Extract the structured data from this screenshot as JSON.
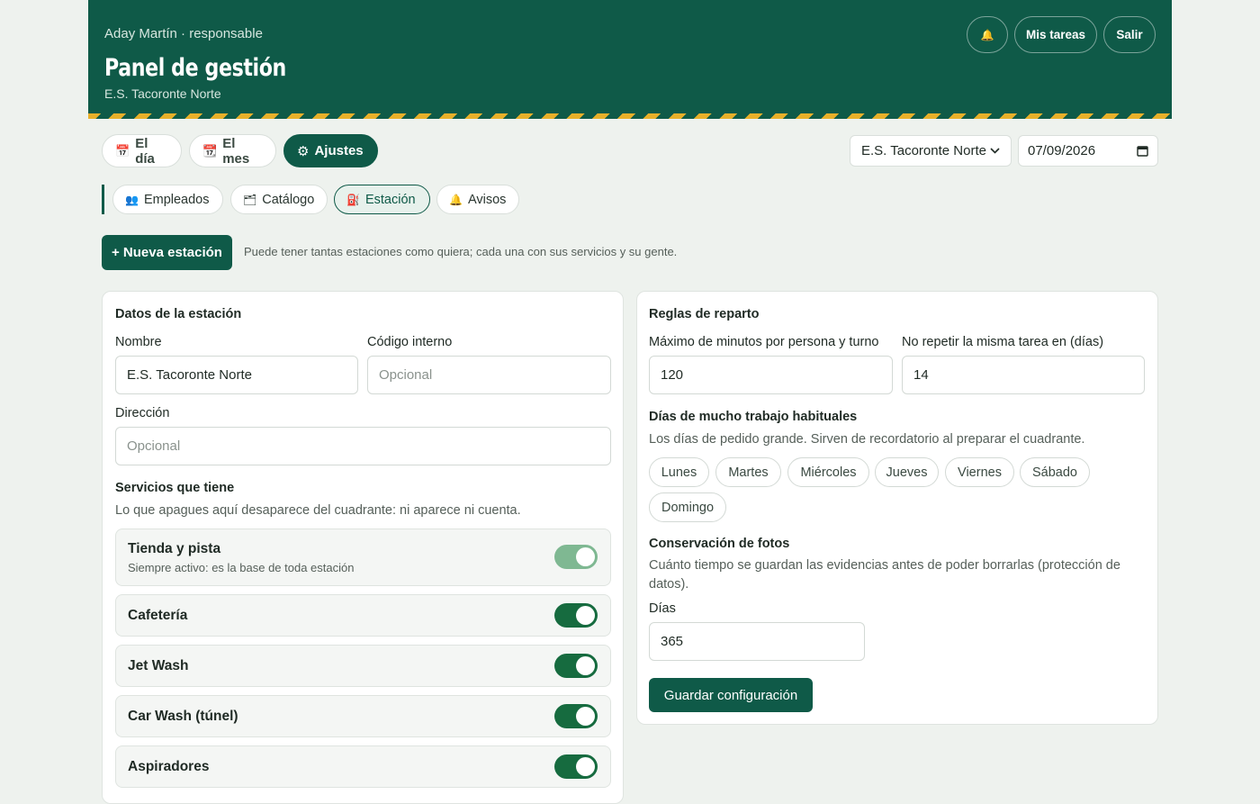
{
  "header": {
    "user": "Aday Martín · responsable",
    "title": "Panel de gestión",
    "station": "E.S. Tacoronte Norte",
    "bell_icon": "bell-icon",
    "bell": "🔔",
    "tasks_label": "Mis tareas",
    "logout_label": "Salir",
    "stripe_color": "#e8b02a",
    "bg_color": "#0f5a48"
  },
  "main_tabs": [
    {
      "icon": "📅",
      "label": "El día"
    },
    {
      "icon": "📆",
      "label": "El mes"
    },
    {
      "icon": "⚙",
      "label": "Ajustes"
    }
  ],
  "station_select": "E.S. Tacoronte Norte",
  "date_value": "07/09/2026",
  "sub_tabs": [
    {
      "icon": "👥",
      "label": "Empleados"
    },
    {
      "icon": "🗂",
      "label": "Catálogo"
    },
    {
      "icon": "⛽",
      "label": "Estación"
    },
    {
      "icon": "🔔",
      "label": "Avisos"
    }
  ],
  "new_station": {
    "label": "+ Nueva estación",
    "hint": "Puede tener tantas estaciones como quiera; cada una con sus servicios y su gente."
  },
  "station_card": {
    "title": "Datos de la estación",
    "name_label": "Nombre",
    "name_value": "E.S. Tacoronte Norte",
    "code_label": "Código interno",
    "code_placeholder": "Opcional",
    "address_label": "Dirección",
    "address_placeholder": "Opcional",
    "services_title": "Servicios que tiene",
    "services_hint": "Lo que apagues aquí desaparece del cuadrante: ni aparece ni cuenta.",
    "services": [
      {
        "name": "Tienda y pista",
        "desc": "Siempre activo: es la base de toda estación"
      },
      {
        "name": "Cafetería"
      },
      {
        "name": "Jet Wash"
      },
      {
        "name": "Car Wash (túnel)"
      },
      {
        "name": "Aspiradores"
      }
    ]
  },
  "rules_card": {
    "title": "Reglas de reparto",
    "max_label": "Máximo de minutos por persona y turno",
    "max_value": "120",
    "norepeat_label": "No repetir la misma tarea en (días)",
    "norepeat_value": "14",
    "busy_title": "Días de mucho trabajo habituales",
    "busy_hint": "Los días de pedido grande. Sirven de recordatorio al preparar el cuadrante.",
    "days": [
      "Lunes",
      "Martes",
      "Miércoles",
      "Jueves",
      "Viernes",
      "Sábado",
      "Domingo"
    ],
    "photos_title": "Conservación de fotos",
    "photos_hint": "Cuánto tiempo se guardan las evidencias antes de poder borrarlas (protección de datos).",
    "days_label": "Días",
    "days_value": "365",
    "save_label": "Guardar configuración"
  }
}
